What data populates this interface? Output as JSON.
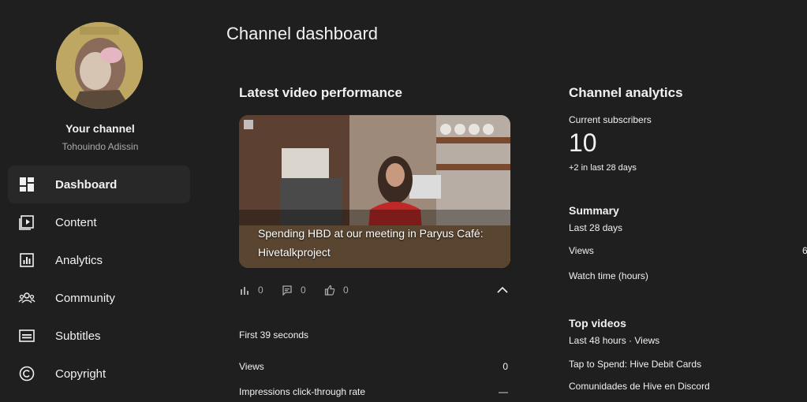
{
  "page": {
    "title": "Channel dashboard"
  },
  "sidebar": {
    "channel_title": "Your channel",
    "channel_name": "Tohouindo Adissin",
    "items": [
      {
        "label": "Dashboard",
        "icon": "dashboard-icon"
      },
      {
        "label": "Content",
        "icon": "content-icon"
      },
      {
        "label": "Analytics",
        "icon": "analytics-icon"
      },
      {
        "label": "Community",
        "icon": "community-icon"
      },
      {
        "label": "Subtitles",
        "icon": "subtitles-icon"
      },
      {
        "label": "Copyright",
        "icon": "copyright-icon"
      }
    ]
  },
  "latest_video": {
    "heading": "Latest video performance",
    "video_title": "Spending HBD at our meeting in Paryus Café: Hivetalkproject",
    "stats": {
      "views": "0",
      "comments": "0",
      "likes": "0"
    },
    "period": "First 39 seconds",
    "rows": [
      {
        "label": "Views",
        "value": "0"
      },
      {
        "label": "Impressions click-through rate",
        "value": "—"
      }
    ]
  },
  "analytics": {
    "heading": "Channel analytics",
    "current_subscribers_label": "Current subscribers",
    "current_subscribers": "10",
    "subscriber_change": "+2 in last 28 days",
    "summary_heading": "Summary",
    "summary_period": "Last 28 days",
    "summary_rows": [
      {
        "label": "Views",
        "value": "6"
      },
      {
        "label": "Watch time (hours)",
        "value": ""
      }
    ],
    "top_videos_heading": "Top videos",
    "top_videos_period": "Last 48 hours · Views",
    "top_videos": [
      {
        "title": "Tap to Spend: Hive Debit Cards"
      },
      {
        "title": "Comunidades de Hive en Discord"
      }
    ]
  },
  "colors": {
    "background": "#1f1f1f",
    "active_nav": "#282828",
    "text": "#f1f1f1",
    "muted": "#aaaaaa"
  }
}
